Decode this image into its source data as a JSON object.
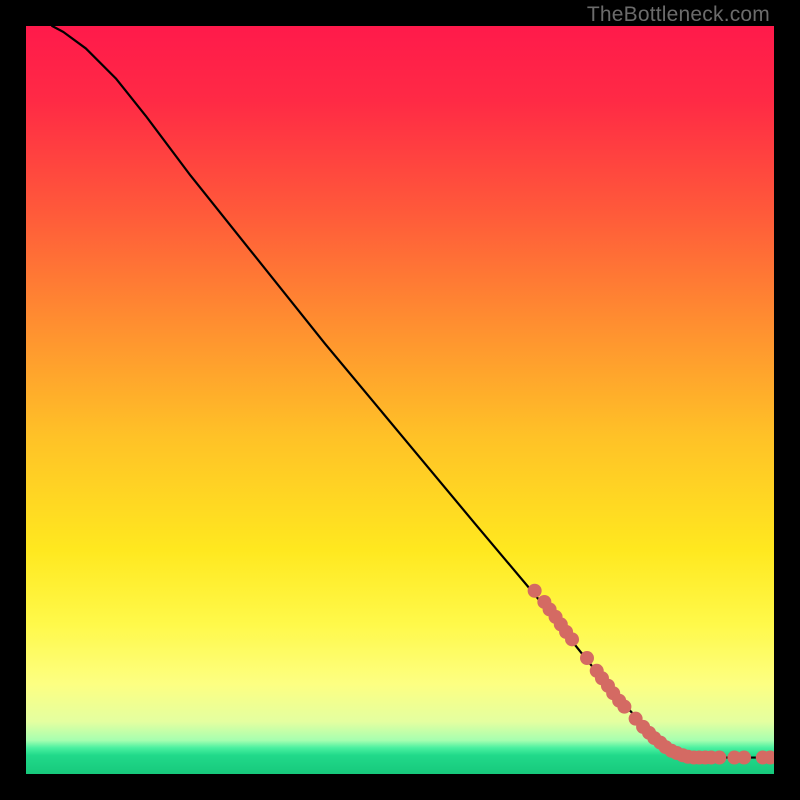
{
  "watermark": "TheBottleneck.com",
  "chart_data": {
    "type": "line",
    "title": "",
    "xlabel": "",
    "ylabel": "",
    "xlim": [
      0,
      100
    ],
    "ylim": [
      0,
      100
    ],
    "gradient_stops": [
      {
        "pos": 0.0,
        "color": "#ff1a4b"
      },
      {
        "pos": 0.1,
        "color": "#ff2a45"
      },
      {
        "pos": 0.25,
        "color": "#ff5a3a"
      },
      {
        "pos": 0.4,
        "color": "#ff8f30"
      },
      {
        "pos": 0.55,
        "color": "#ffc227"
      },
      {
        "pos": 0.7,
        "color": "#ffe81f"
      },
      {
        "pos": 0.8,
        "color": "#fff94a"
      },
      {
        "pos": 0.88,
        "color": "#fdff82"
      },
      {
        "pos": 0.93,
        "color": "#e4ffa0"
      },
      {
        "pos": 0.955,
        "color": "#a6ffb0"
      },
      {
        "pos": 0.965,
        "color": "#4af0a0"
      },
      {
        "pos": 0.975,
        "color": "#21d98a"
      },
      {
        "pos": 1.0,
        "color": "#17c97c"
      }
    ],
    "curve": [
      {
        "x": 3.5,
        "y": 100.0
      },
      {
        "x": 5.0,
        "y": 99.2
      },
      {
        "x": 8.0,
        "y": 97.0
      },
      {
        "x": 12.0,
        "y": 93.0
      },
      {
        "x": 16.0,
        "y": 88.0
      },
      {
        "x": 22.0,
        "y": 80.0
      },
      {
        "x": 30.0,
        "y": 70.0
      },
      {
        "x": 40.0,
        "y": 57.5
      },
      {
        "x": 50.0,
        "y": 45.5
      },
      {
        "x": 60.0,
        "y": 33.5
      },
      {
        "x": 68.0,
        "y": 24.0
      },
      {
        "x": 74.0,
        "y": 16.5
      },
      {
        "x": 78.0,
        "y": 11.5
      },
      {
        "x": 81.0,
        "y": 8.2
      },
      {
        "x": 83.5,
        "y": 5.5
      },
      {
        "x": 85.5,
        "y": 3.8
      },
      {
        "x": 87.0,
        "y": 2.9
      },
      {
        "x": 88.5,
        "y": 2.4
      },
      {
        "x": 90.0,
        "y": 2.2
      },
      {
        "x": 100.0,
        "y": 2.2
      }
    ],
    "markers": {
      "color": "#d46a63",
      "radius": 7,
      "points": [
        {
          "x": 68.0,
          "y": 24.5
        },
        {
          "x": 69.3,
          "y": 23.0
        },
        {
          "x": 70.0,
          "y": 22.0
        },
        {
          "x": 70.8,
          "y": 21.0
        },
        {
          "x": 71.5,
          "y": 20.0
        },
        {
          "x": 72.2,
          "y": 19.0
        },
        {
          "x": 73.0,
          "y": 18.0
        },
        {
          "x": 75.0,
          "y": 15.5
        },
        {
          "x": 76.3,
          "y": 13.8
        },
        {
          "x": 77.0,
          "y": 12.8
        },
        {
          "x": 77.8,
          "y": 11.8
        },
        {
          "x": 78.5,
          "y": 10.8
        },
        {
          "x": 79.3,
          "y": 9.8
        },
        {
          "x": 80.0,
          "y": 9.0
        },
        {
          "x": 81.5,
          "y": 7.4
        },
        {
          "x": 82.5,
          "y": 6.3
        },
        {
          "x": 83.3,
          "y": 5.5
        },
        {
          "x": 84.0,
          "y": 4.8
        },
        {
          "x": 84.8,
          "y": 4.2
        },
        {
          "x": 85.5,
          "y": 3.6
        },
        {
          "x": 86.3,
          "y": 3.1
        },
        {
          "x": 87.0,
          "y": 2.8
        },
        {
          "x": 87.8,
          "y": 2.5
        },
        {
          "x": 88.5,
          "y": 2.3
        },
        {
          "x": 89.3,
          "y": 2.2
        },
        {
          "x": 90.0,
          "y": 2.2
        },
        {
          "x": 90.8,
          "y": 2.2
        },
        {
          "x": 91.6,
          "y": 2.2
        },
        {
          "x": 92.7,
          "y": 2.2
        },
        {
          "x": 94.7,
          "y": 2.2
        },
        {
          "x": 96.0,
          "y": 2.2
        },
        {
          "x": 98.5,
          "y": 2.2
        },
        {
          "x": 99.5,
          "y": 2.2
        }
      ]
    }
  }
}
